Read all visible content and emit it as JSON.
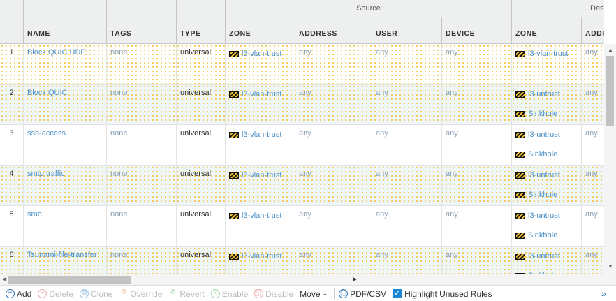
{
  "header": {
    "groups": {
      "source": "Source",
      "destination": "Dest"
    },
    "columns": {
      "name": "NAME",
      "tags": "TAGS",
      "type": "TYPE",
      "src_zone": "ZONE",
      "src_address": "ADDRESS",
      "user": "USER",
      "device": "DEVICE",
      "dst_zone": "ZONE",
      "dst_address": "ADDRESS"
    }
  },
  "rows": [
    {
      "num": "1",
      "name": "Block QUIC UDP",
      "tags": "none",
      "type": "universal",
      "src_zone": "l3-vlan-trust",
      "src_address": "any",
      "user": "any",
      "device": "any",
      "dst_zones": [
        "l3-vlan-trust"
      ],
      "dst_address": "any",
      "highlighted": true
    },
    {
      "num": "2",
      "name": "Block QUIC",
      "tags": "none",
      "type": "universal",
      "src_zone": "l3-vlan-trust",
      "src_address": "any",
      "user": "any",
      "device": "any",
      "dst_zones": [
        "l3-untrust",
        "Sinkhole"
      ],
      "dst_address": "any",
      "highlighted": true
    },
    {
      "num": "3",
      "name": "ssh-access",
      "tags": "none",
      "type": "universal",
      "src_zone": "l3-vlan-trust",
      "src_address": "any",
      "user": "any",
      "device": "any",
      "dst_zones": [
        "l3-untrust",
        "Sinkhole"
      ],
      "dst_address": "any",
      "highlighted": false
    },
    {
      "num": "4",
      "name": "smtp traffic",
      "tags": "none",
      "type": "universal",
      "src_zone": "l3-vlan-trust",
      "src_address": "any",
      "user": "any",
      "device": "any",
      "dst_zones": [
        "l3-untrust",
        "Sinkhole"
      ],
      "dst_address": "any",
      "highlighted": true
    },
    {
      "num": "5",
      "name": "smb",
      "tags": "none",
      "type": "universal",
      "src_zone": "l3-vlan-trust",
      "src_address": "any",
      "user": "any",
      "device": "any",
      "dst_zones": [
        "l3-untrust",
        "Sinkhole"
      ],
      "dst_address": "any",
      "highlighted": false
    },
    {
      "num": "6",
      "name": "Tsunami-file-transfer",
      "tags": "none",
      "type": "universal",
      "src_zone": "l3-vlan-trust",
      "src_address": "any",
      "user": "any",
      "device": "any",
      "dst_zones": [
        "l3-untrust",
        "Sinkhole"
      ],
      "dst_address": "any",
      "highlighted": true
    }
  ],
  "toolbar": {
    "add": "Add",
    "delete": "Delete",
    "clone": "Clone",
    "override": "Override",
    "revert": "Revert",
    "enable": "Enable",
    "disable": "Disable",
    "move": "Move",
    "pdf_csv": "PDF/CSV",
    "highlight_unused": "Highlight Unused Rules",
    "highlight_checked": true,
    "more": "»"
  },
  "colors": {
    "highlight_dots": "#f7c23a",
    "link": "#4a8fc7",
    "accent": "#1d87d7"
  }
}
